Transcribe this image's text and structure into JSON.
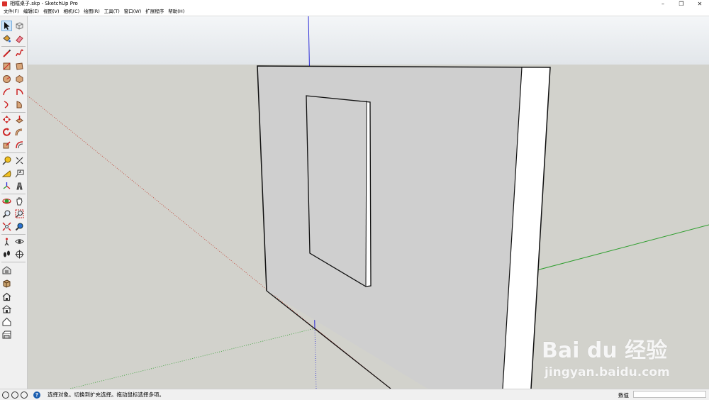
{
  "window": {
    "title": "相框桌子.skp - SketchUp Pro",
    "controls": [
      "–",
      "❐",
      "✕"
    ]
  },
  "menu": [
    "文件(F)",
    "编辑(E)",
    "视图(V)",
    "相机(C)",
    "绘图(R)",
    "工具(T)",
    "窗口(W)",
    "扩展程序",
    "帮助(H)"
  ],
  "toolbar": {
    "selected_tool": "select-tool",
    "tools": [
      "select-tool",
      "component-tool",
      "paint-bucket-tool",
      "eraser-tool",
      "line-tool",
      "freehand-tool",
      "rectangle-tool",
      "rotated-rectangle-tool",
      "circle-tool",
      "polygon-tool",
      "arc-tool",
      "pie-tool",
      "two-point-arc-tool",
      "three-point-arc-tool",
      "move-tool",
      "push-pull-tool",
      "rotate-tool",
      "follow-me-tool",
      "scale-tool",
      "offset-tool",
      "tape-measure-tool",
      "dimension-tool",
      "protractor-tool",
      "text-tool",
      "axes-tool",
      "3d-text-tool",
      "orbit-tool",
      "pan-tool",
      "zoom-tool",
      "zoom-window-tool",
      "zoom-extents-tool",
      "previous-view-tool",
      "position-camera-tool",
      "look-around-tool",
      "walk-tool",
      "section-plane-tool",
      "warehouse-tool",
      "extension-warehouse-tool",
      "home-view",
      "front-view",
      "top-view",
      "right-view"
    ]
  },
  "colors": {
    "sky": "#e6eaee",
    "ground": "#d2d2cc",
    "face": "#cfcfcf",
    "axis_red": "#c0392b",
    "axis_green": "#2e9e2e",
    "axis_blue": "#2a2ad8",
    "selection": "#cde3f7"
  },
  "watermark": {
    "logo": "Bai du 经验",
    "url": "jingyan.baidu.com"
  },
  "statusbar": {
    "icons": [
      "geo-location-icon",
      "credits-icon",
      "user-icon",
      "help-icon"
    ],
    "hint": "选择对象。切换到扩充选择。拖动鼠标选择多项。",
    "measurement_label": "数值",
    "measurement_value": ""
  }
}
